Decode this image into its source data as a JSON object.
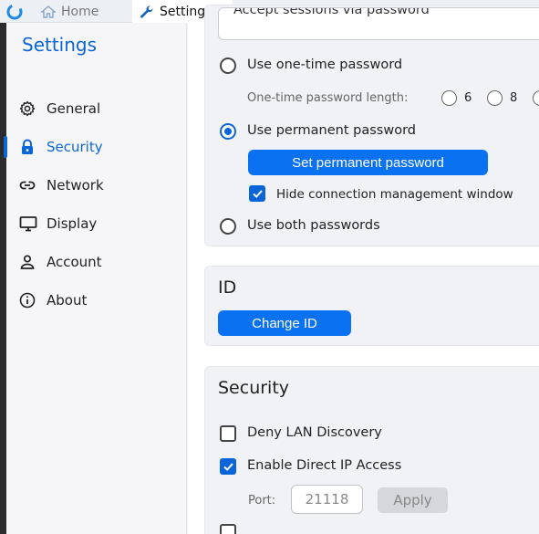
{
  "tabs": [
    {
      "label": "Home",
      "icon": "home-icon"
    },
    {
      "label": "Settings",
      "icon": "wrench-icon"
    }
  ],
  "sidebar": {
    "title": "Settings",
    "items": [
      {
        "label": "General",
        "icon": "gear-icon"
      },
      {
        "label": "Security",
        "icon": "lock-icon",
        "active": true
      },
      {
        "label": "Network",
        "icon": "link-icon"
      },
      {
        "label": "Display",
        "icon": "monitor-icon"
      },
      {
        "label": "Account",
        "icon": "person-icon"
      },
      {
        "label": "About",
        "icon": "info-icon"
      }
    ]
  },
  "password": {
    "cut_option": "Accept sessions via password",
    "one_time_label": "Use one-time password",
    "length_label": "One-time password length:",
    "length_options": [
      "6",
      "8"
    ],
    "permanent_label": "Use permanent password",
    "set_permanent_button": "Set permanent password",
    "hide_window_label": "Hide connection management window",
    "both_label": "Use both passwords"
  },
  "id_section": {
    "title": "ID",
    "change_button": "Change ID"
  },
  "security_section": {
    "title": "Security",
    "deny_lan_label": "Deny LAN Discovery",
    "direct_ip_label": "Enable Direct IP Access",
    "port_label": "Port:",
    "port_value": "21118",
    "apply_button": "Apply"
  },
  "colors": {
    "accent": "#0a66d8",
    "button": "#0a72f0"
  }
}
